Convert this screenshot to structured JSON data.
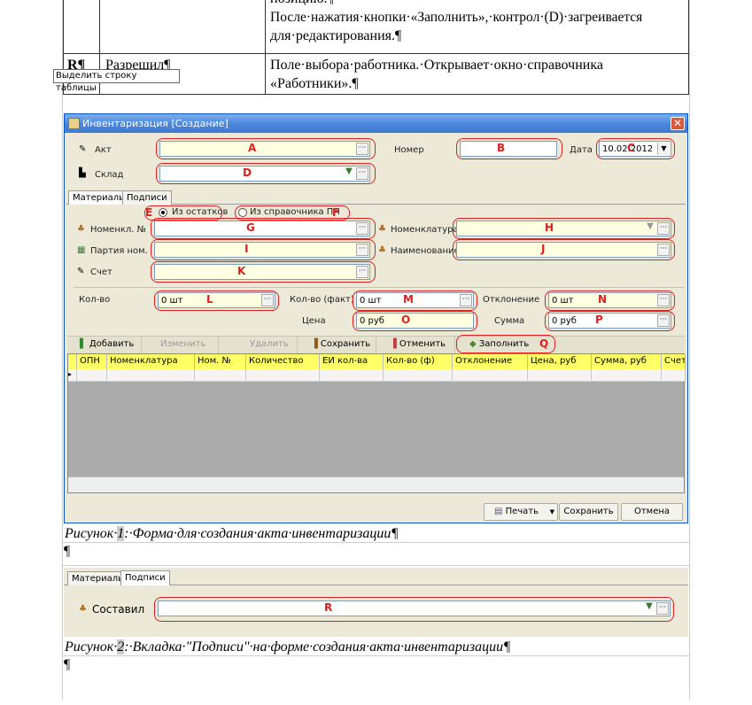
{
  "doc": {
    "row1_text_partial": "позицию.¶",
    "row1_text_line2": "После·нажатия·кнопки·«Заполнить»,·контрол·(D)·загреивается",
    "row1_text_line3": "для·редактирования.¶",
    "row2_col1": "R¶",
    "row2_col2": "Разрешил¶",
    "row2_col3_line1": "Поле·выбора·работника.·Открывает·окно·справочника",
    "row2_col3_line2": "«Работники».¶",
    "tooltip": "Выделить строку таблицы",
    "caption1_prefix": "Рисунок·",
    "caption1_num": "1",
    "caption1_text": ":·Форма·для·создания·акта·инвентаризации¶",
    "para_mark1": "¶",
    "caption2_prefix": "Рисунок·",
    "caption2_num": "2",
    "caption2_text": ":·Вкладка·\"Подписи\"·на·форме·создания·акта·инвентаризации¶",
    "para_mark2": "¶"
  },
  "window": {
    "title": "Инвентаризация [Создание]",
    "close": "✕",
    "labels": {
      "akt": "Акт",
      "nomer": "Номер",
      "data": "Дата",
      "sklad": "Склад",
      "nomenkl_no": "Номенкл. №",
      "nomenklatura": "Номенклатура",
      "partiya": "Партия ном.",
      "naimenovanie": "Наименование",
      "schet": "Счет",
      "kolvo": "Кол-во",
      "kolvo_fakt": "Кол-во (факт)",
      "otklonenie": "Отклонение",
      "cena": "Цена",
      "summa": "Сумма"
    },
    "values": {
      "date": "10.02.2012",
      "kolvo": "0 шт",
      "kolvo_fakt": "0 шт",
      "otklonenie": "0 шт",
      "cena": "0 руб",
      "summa": "0 руб"
    },
    "markers": {
      "A": "A",
      "B": "B",
      "C": "C",
      "D": "D",
      "E": "E",
      "F": "F",
      "G": "G",
      "H": "H",
      "I": "I",
      "J": "J",
      "K": "K",
      "L": "L",
      "M": "M",
      "N": "N",
      "O": "O",
      "P": "P",
      "Q": "Q",
      "R": "R"
    },
    "tabs": [
      "Материалы",
      "Подписи"
    ],
    "radio": {
      "from_stock": "Из остатков",
      "from_ref": "Из справочника ПН"
    },
    "toolbar": {
      "add": "Добавить",
      "edit": "Изменить",
      "delete": "Удалить",
      "save": "Сохранить",
      "cancel": "Отменить",
      "fill": "Заполнить"
    },
    "grid_headers": [
      "ОПН",
      "Номенклатура",
      "Ном. №",
      "Количество",
      "ЕИ кол-ва",
      "Кол-во (ф)",
      "Отклонение",
      "Цена, руб",
      "Сумма, руб",
      "Счет"
    ],
    "bottom": {
      "print": "Печать",
      "save": "Сохранить",
      "cancel": "Отмена"
    },
    "ellipsis": "···"
  },
  "panel2": {
    "tabs": [
      "Материалы",
      "Подписи"
    ],
    "label": "Составил"
  },
  "colors": {
    "highlight_red": "#e02020",
    "grid_header": "#ffff66",
    "title_bar": "#4b88dc"
  }
}
